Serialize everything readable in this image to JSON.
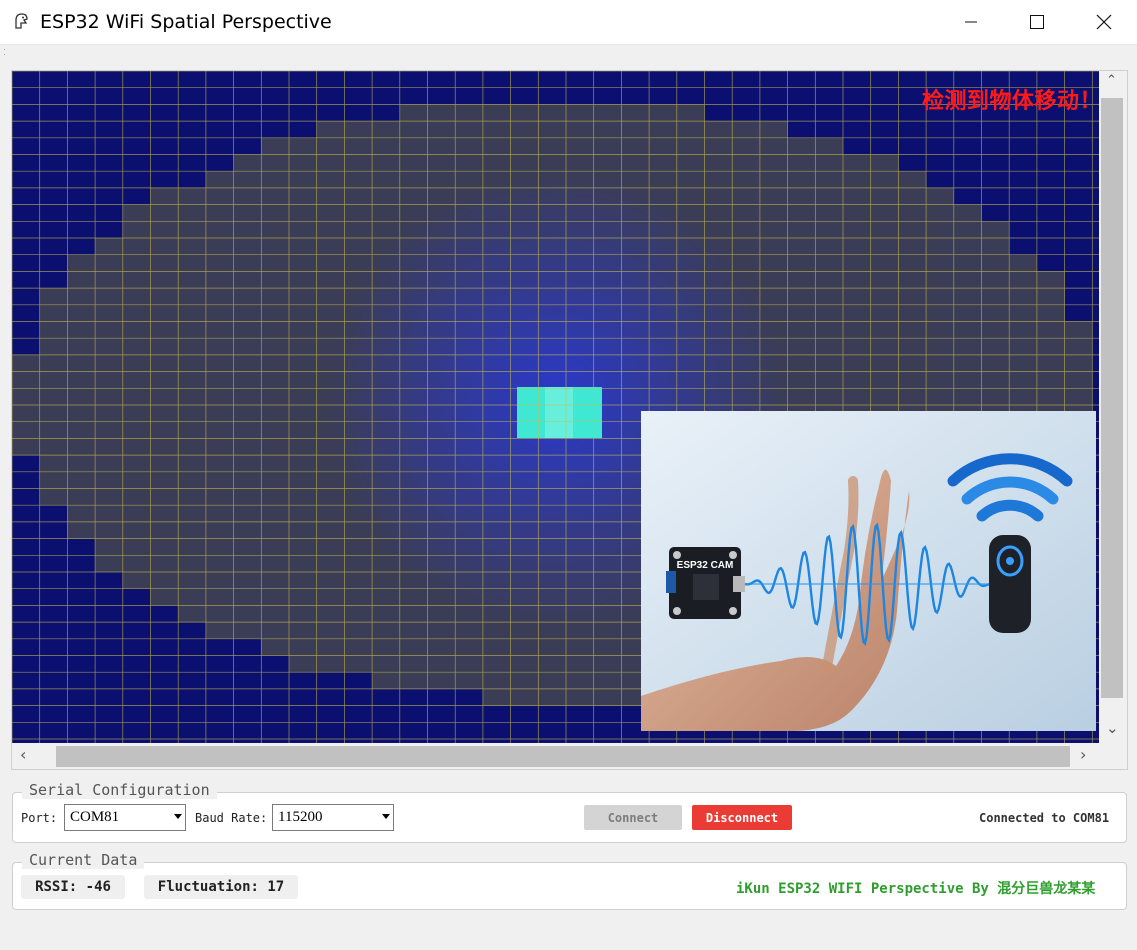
{
  "window": {
    "title": "ESP32 WiFi Spatial Perspective",
    "icons": [
      "app-icon",
      "minimize-icon",
      "maximize-icon",
      "close-icon"
    ]
  },
  "canvas": {
    "alert_text": "检测到物体移动！",
    "colors": {
      "background": "#0a0e6e",
      "grid_line": "#d8cc55",
      "hotspot": "#3af0d8"
    },
    "illustration": {
      "chip_label": "ESP32 CAM"
    }
  },
  "serial": {
    "legend": "Serial Configuration",
    "port_label": "Port:",
    "port_value": "COM81",
    "baud_label": "Baud Rate:",
    "baud_value": "115200",
    "connect_label": "Connect",
    "disconnect_label": "Disconnect",
    "status": "Connected to COM81",
    "colors": {
      "disconnect": "#ea3c35",
      "connect_disabled": "#d4d4d4"
    }
  },
  "current": {
    "legend": "Current Data",
    "rssi": "RSSI: -46",
    "fluctuation": "Fluctuation: 17",
    "credit": "iKun ESP32 WIFI Perspective By 混分巨兽龙某某",
    "credit_color": "#2f9e2f"
  }
}
